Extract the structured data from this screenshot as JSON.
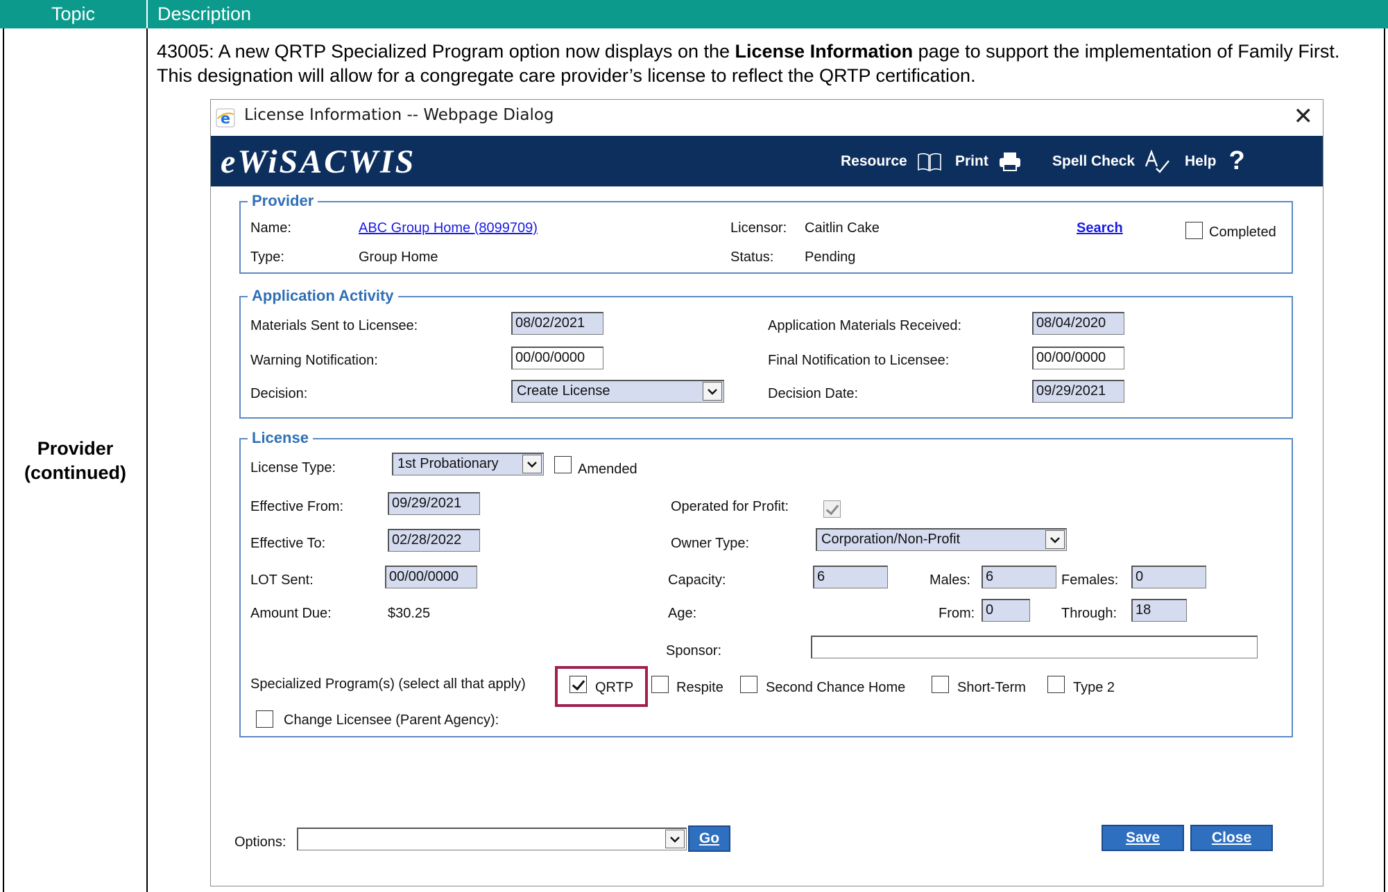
{
  "doc": {
    "col_topic": "Topic",
    "col_description": "Description",
    "topic_line1": "Provider",
    "topic_line2": "(continued)",
    "desc_pre": "43005: A new QRTP Specialized Program option now displays on the ",
    "desc_bold": "License Information",
    "desc_post": " page to support the implementation of Family First. This designation will allow for a congregate care provider’s license to reflect the QRTP certification."
  },
  "dialog": {
    "title": "License Information -- Webpage Dialog",
    "close_glyph": "✕",
    "logo": "eWiSACWIS",
    "nav": {
      "resource": "Resource",
      "print": "Print",
      "spell_check": "Spell Check",
      "help": "Help",
      "help_glyph": "?"
    }
  },
  "provider": {
    "legend": "Provider",
    "name_label": "Name:",
    "name_value": "ABC Group Home  (8099709)",
    "type_label": "Type:",
    "type_value": "Group Home",
    "licensor_label": "Licensor:",
    "licensor_value": "Caitlin Cake",
    "status_label": "Status:",
    "status_value": "Pending",
    "search_link": "Search",
    "completed_label": "Completed"
  },
  "application": {
    "legend": "Application Activity",
    "materials_sent_label": "Materials Sent to Licensee:",
    "materials_sent_value": "08/02/2021",
    "warning_label": "Warning Notification:",
    "warning_value": "00/00/0000",
    "decision_label": "Decision:",
    "decision_value": "Create License",
    "materials_received_label": "Application Materials Received:",
    "materials_received_value": "08/04/2020",
    "final_notification_label": "Final Notification to Licensee:",
    "final_notification_value": "00/00/0000",
    "decision_date_label": "Decision Date:",
    "decision_date_value": "09/29/2021"
  },
  "license": {
    "legend": "License",
    "license_type_label": "License Type:",
    "license_type_value": "1st Probationary",
    "amended_label": "Amended",
    "effective_from_label": "Effective From:",
    "effective_from_value": "09/29/2021",
    "effective_to_label": "Effective To:",
    "effective_to_value": "02/28/2022",
    "lot_sent_label": "LOT Sent:",
    "lot_sent_value": "00/00/0000",
    "amount_due_label": "Amount Due:",
    "amount_due_value": "$30.25",
    "operated_profit_label": "Operated for Profit:",
    "owner_type_label": "Owner Type:",
    "owner_type_value": "Corporation/Non-Profit",
    "capacity_label": "Capacity:",
    "capacity_value": "6",
    "males_label": "Males:",
    "males_value": "6",
    "females_label": "Females:",
    "females_value": "0",
    "age_label": "Age:",
    "from_label": "From:",
    "from_value": "0",
    "through_label": "Through:",
    "through_value": "18",
    "sponsor_label": "Sponsor:",
    "sponsor_value": "",
    "specialized_label": "Specialized Program(s) (select all that apply)",
    "programs": {
      "qrtp": "QRTP",
      "respite": "Respite",
      "second_chance": "Second Chance Home",
      "short_term": "Short-Term",
      "type2": "Type 2"
    },
    "change_licensee_label": "Change Licensee (Parent Agency):"
  },
  "footer": {
    "options_label": "Options:",
    "options_value": "",
    "go_label": "Go",
    "save_label": "Save",
    "close_label": "Close"
  },
  "colors": {
    "header_teal": "#0b9a8c",
    "banner_navy": "#0d2f5e",
    "fieldset_blue": "#5a88c4",
    "highlight_maroon": "#a01f4f",
    "button_blue": "#2e6fc0"
  }
}
